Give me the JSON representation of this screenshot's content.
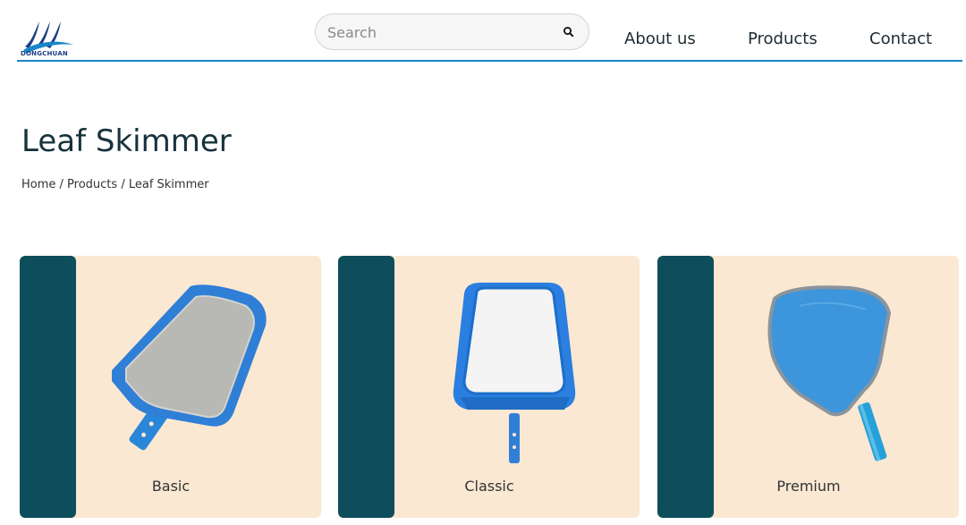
{
  "brand": {
    "logo_text": "DONGCHUAN",
    "color": "#1a3f86"
  },
  "search": {
    "placeholder": "Search",
    "value": "",
    "icon": "search-icon"
  },
  "nav": {
    "about": "About us",
    "products": "Products",
    "contact": "Contact"
  },
  "page": {
    "title": "Leaf Skimmer"
  },
  "breadcrumb": {
    "home": "Home",
    "products": "Products",
    "current": "Leaf Skimmer",
    "separator": "/"
  },
  "products": [
    {
      "label": "Basic",
      "image": "skimmer-basic-image"
    },
    {
      "label": "Classic",
      "image": "skimmer-classic-image"
    },
    {
      "label": "Premium",
      "image": "skimmer-premium-image"
    }
  ],
  "colors": {
    "accent": "#1a86c8",
    "card_bg": "#fae8d3",
    "card_bar": "#0e4e5c",
    "title": "#17323c"
  }
}
